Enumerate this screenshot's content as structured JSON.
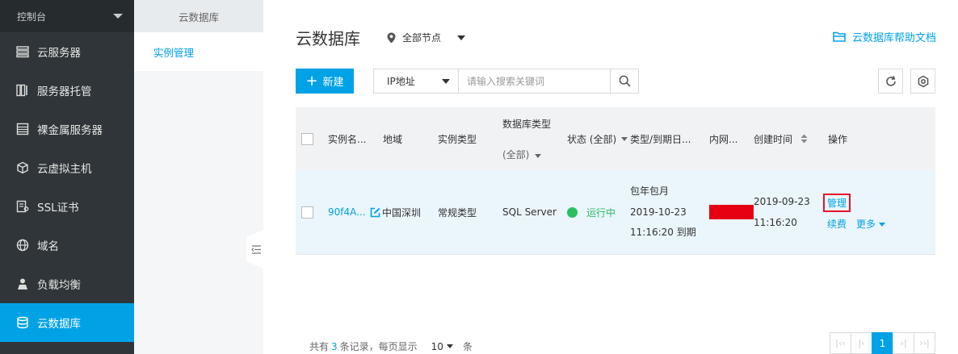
{
  "sidebar": {
    "console_label": "控制台",
    "items": [
      {
        "label": "云服务器",
        "icon": "server-list-icon"
      },
      {
        "label": "服务器托管",
        "icon": "server-hosting-icon"
      },
      {
        "label": "裸金属服务器",
        "icon": "bare-metal-icon"
      },
      {
        "label": "云虚拟主机",
        "icon": "cube-icon"
      },
      {
        "label": "SSL证书",
        "icon": "certificate-icon"
      },
      {
        "label": "域名",
        "icon": "globe-icon"
      },
      {
        "label": "负载均衡",
        "icon": "load-balance-icon"
      },
      {
        "label": "云数据库",
        "icon": "database-icon",
        "active": true
      }
    ]
  },
  "subnav": {
    "title": "云数据库",
    "items": [
      {
        "label": "实例管理"
      }
    ]
  },
  "header": {
    "title": "云数据库",
    "region": "全部节点",
    "help_link": "云数据库帮助文档"
  },
  "toolbar": {
    "new_label": "新建",
    "search_type": "IP地址",
    "search_placeholder": "请输入搜索关键词"
  },
  "table": {
    "headers": {
      "name": "实例名...",
      "region": "地域",
      "instance_type": "实例类型",
      "db_type": "数据库类型",
      "db_type_filter": "(全部)",
      "status": "状态 (全部)",
      "billing": "类型/到期日...",
      "intranet": "内网...",
      "created": "创建时间",
      "actions": "操作"
    },
    "rows": [
      {
        "name": "90f4A...",
        "region": "中国深圳",
        "instance_type": "常规类型",
        "db_type": "SQL Server",
        "status": "运行中",
        "billing_type": "包年包月",
        "expire_date": "2019-10-23",
        "expire_time": "11:16:20 到期",
        "created_date": "2019-09-23",
        "created_time": "11:16:20",
        "action_manage": "管理",
        "action_renew": "续费",
        "action_more": "更多"
      }
    ]
  },
  "footer": {
    "total_prefix": "共有",
    "total_count": "3",
    "total_suffix": "条记录，每页显示",
    "page_size": "10",
    "page_size_unit": "条",
    "current_page": "1"
  },
  "colors": {
    "accent": "#00a2e6",
    "sidebar_bg": "#2f3538",
    "status_running": "#2bbf62",
    "highlight_box": "#e6122a",
    "redaction": "#e60012"
  }
}
